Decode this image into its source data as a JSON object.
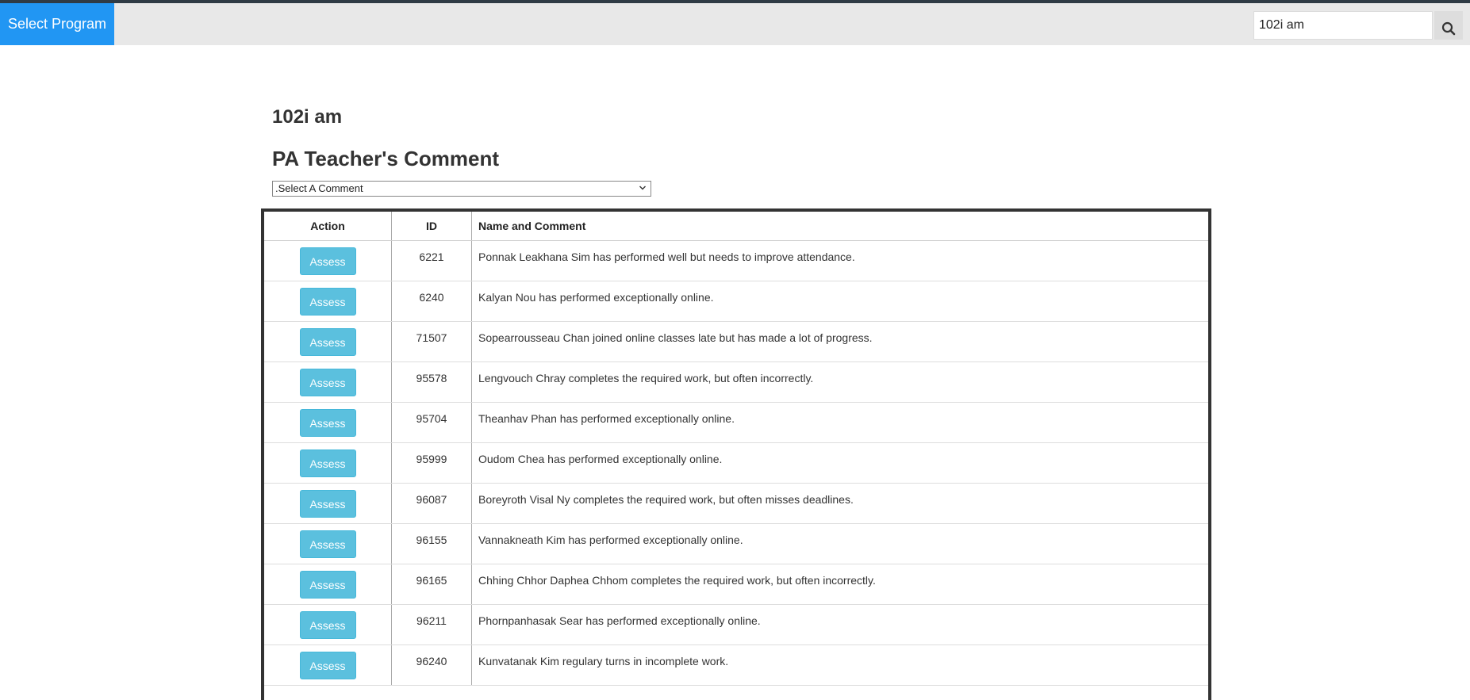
{
  "topbar": {
    "select_program_label": "Select Program",
    "search_value": "102i am",
    "search_icon": "search-icon"
  },
  "main": {
    "class_title": "102i am",
    "comment_heading": "PA Teacher's Comment",
    "comment_select_value": ".Select A Comment"
  },
  "table": {
    "headers": [
      "Action",
      "ID",
      "Name and Comment"
    ],
    "action_label": "Assess",
    "rows": [
      {
        "id": "6221",
        "comment": "Ponnak Leakhana Sim has performed well but needs to improve attendance."
      },
      {
        "id": "6240",
        "comment": "Kalyan Nou has performed exceptionally online."
      },
      {
        "id": "71507",
        "comment": "Sopearrousseau Chan joined online classes late but has made a lot of progress."
      },
      {
        "id": "95578",
        "comment": "Lengvouch Chray completes the required work, but often incorrectly."
      },
      {
        "id": "95704",
        "comment": "Theanhav Phan has performed exceptionally online."
      },
      {
        "id": "95999",
        "comment": "Oudom Chea has performed exceptionally online."
      },
      {
        "id": "96087",
        "comment": "Boreyroth Visal Ny completes the required work, but often misses deadlines."
      },
      {
        "id": "96155",
        "comment": "Vannakneath Kim has performed exceptionally online."
      },
      {
        "id": "96165",
        "comment": "Chhing Chhor Daphea Chhom completes the required work, but often incorrectly."
      },
      {
        "id": "96211",
        "comment": "Phornpanhasak Sear has performed exceptionally online."
      },
      {
        "id": "96240",
        "comment": "Kunvatanak Kim regulary turns in incomplete work."
      }
    ]
  },
  "colors": {
    "accent": "#2196f3",
    "assess_button": "#5bc0de",
    "topbar": "#e8e8e8"
  }
}
